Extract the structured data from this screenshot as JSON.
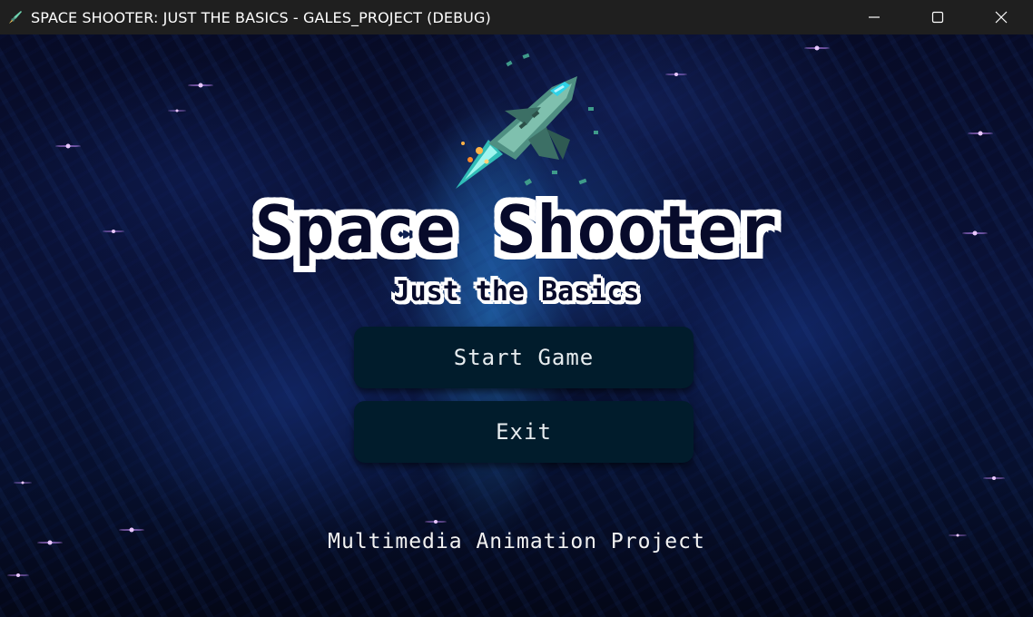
{
  "window": {
    "title": "SPACE SHOOTER: JUST THE BASICS - GALES_PROJECT (DEBUG)",
    "controls": [
      "minimize-icon",
      "maximize-icon",
      "close-icon"
    ]
  },
  "game": {
    "title": "Space Shooter",
    "subtitle": "Just the Basics",
    "buttons": {
      "start": "Start Game",
      "exit": "Exit"
    },
    "footer": "Multimedia Animation Project"
  },
  "colors": {
    "titlebar_bg": "#1f1f1f",
    "button_bg": "#011c2c",
    "button_text": "#e7ecef",
    "title_fill": "#070a2a",
    "title_outline": "#ffffff",
    "star": "#c98cff"
  },
  "icons": {
    "app": "spaceship-icon",
    "hero_art": "spaceship-icon"
  }
}
